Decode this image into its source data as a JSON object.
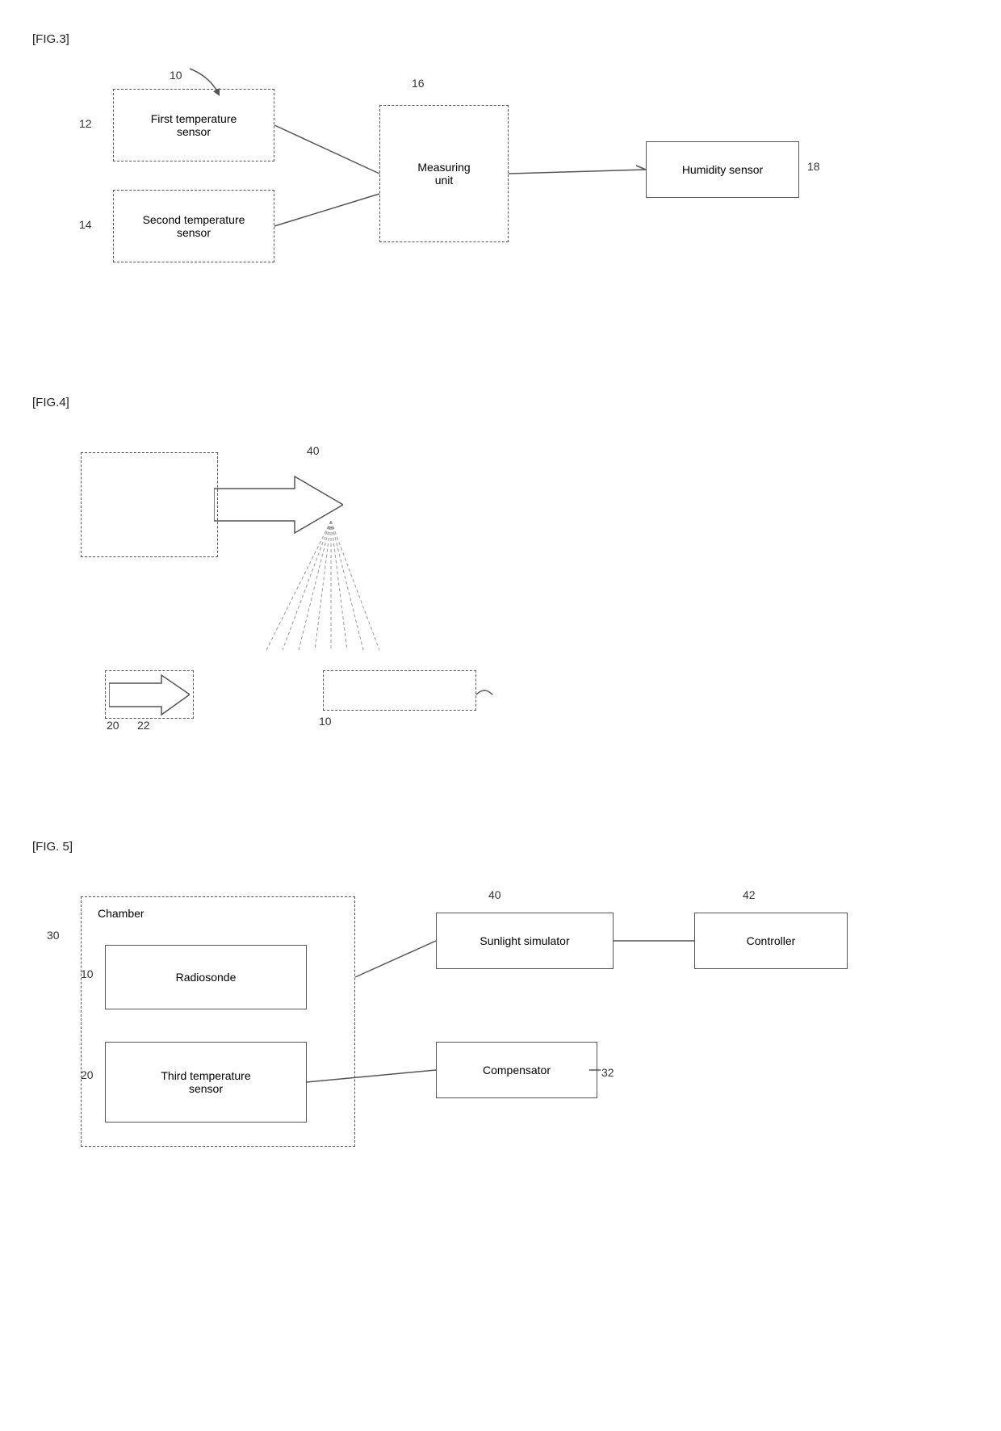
{
  "fig3": {
    "label": "[FIG.3]",
    "ref10": "10",
    "ref12": "12",
    "ref14": "14",
    "ref16": "16",
    "ref18": "18",
    "box_first_temp": "First temperature\nsensor",
    "box_second_temp": "Second temperature\nsensor",
    "box_measuring": "Measuring\nunit",
    "box_humidity": "Humidity sensor"
  },
  "fig4": {
    "label": "[FIG.4]",
    "ref10": "10",
    "ref20": "20",
    "ref22": "22",
    "ref40": "40"
  },
  "fig5": {
    "label": "[FIG. 5]",
    "ref10": "10",
    "ref20": "20",
    "ref30": "30",
    "ref32": "32",
    "ref40": "40",
    "ref42": "42",
    "box_chamber": "Chamber",
    "box_radiosonde": "Radiosonde",
    "box_third_temp": "Third temperature\nsensor",
    "box_sunlight_sim": "Sunlight simulator",
    "box_controller": "Controller",
    "box_compensator": "Compensator"
  }
}
